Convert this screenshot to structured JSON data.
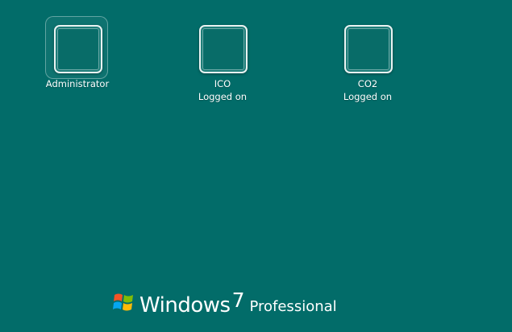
{
  "users": [
    {
      "name": "Administrator",
      "status": ""
    },
    {
      "name": "ICO",
      "status": "Logged on"
    },
    {
      "name": "CO2",
      "status": "Logged on"
    }
  ],
  "branding": {
    "wordmark": "Windows",
    "version": "7",
    "edition": "Professional",
    "flag_colors": [
      "#f35325",
      "#81bc06",
      "#05a6f0",
      "#ffba08"
    ]
  },
  "colors": {
    "background": "#026c69"
  },
  "icons": {
    "user_tile": "user-picture-frame-icon",
    "logo": "windows-flag-icon"
  }
}
